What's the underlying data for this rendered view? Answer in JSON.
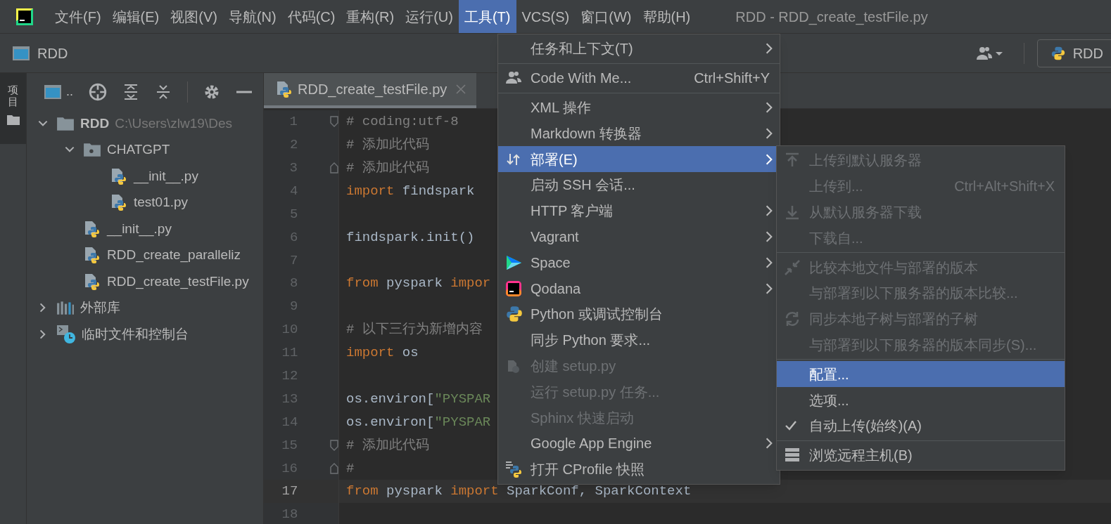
{
  "menubar": {
    "items": [
      {
        "label": "文件(F)",
        "selected": false
      },
      {
        "label": "编辑(E)",
        "selected": false
      },
      {
        "label": "视图(V)",
        "selected": false
      },
      {
        "label": "导航(N)",
        "selected": false
      },
      {
        "label": "代码(C)",
        "selected": false
      },
      {
        "label": "重构(R)",
        "selected": false
      },
      {
        "label": "运行(U)",
        "selected": false
      },
      {
        "label": "工具(T)",
        "selected": true
      },
      {
        "label": "VCS(S)",
        "selected": false
      },
      {
        "label": "窗口(W)",
        "selected": false
      },
      {
        "label": "帮助(H)",
        "selected": false
      }
    ],
    "title": "RDD - RDD_create_testFile.py"
  },
  "navbar": {
    "project": "RDD",
    "run_config": "RDD"
  },
  "side_strip": {
    "label": "项目"
  },
  "project_panel": {
    "toolbar_label": "..",
    "tree": [
      {
        "label": "RDD",
        "path": "C:\\Users\\zlw19\\Des",
        "kind": "folder",
        "expanded": true,
        "children": [
          {
            "label": "CHATGPT",
            "kind": "package",
            "expanded": true,
            "children": [
              {
                "label": "__init__.py",
                "kind": "file"
              },
              {
                "label": "test01.py",
                "kind": "file"
              }
            ]
          },
          {
            "label": "__init__.py",
            "kind": "file"
          },
          {
            "label": "RDD_create_paralleliz",
            "kind": "file"
          },
          {
            "label": "RDD_create_testFile.py",
            "kind": "file"
          }
        ]
      },
      {
        "label": "外部库",
        "kind": "library",
        "expanded": false
      },
      {
        "label": "临时文件和控制台",
        "kind": "scratch",
        "expanded": false
      }
    ]
  },
  "editor": {
    "tabs": [
      {
        "label": "RDD_create_testFile.py",
        "selected": true
      }
    ],
    "lines": [
      {
        "number": "1",
        "fold_start": true,
        "fold_end": false,
        "current": false,
        "tokens": [
          {
            "kind": "comment",
            "text": "# coding:utf-8"
          }
        ]
      },
      {
        "number": "2",
        "fold_start": false,
        "fold_end": false,
        "current": false,
        "tokens": [
          {
            "kind": "comment",
            "text": "# 添加此代码"
          }
        ]
      },
      {
        "number": "3",
        "fold_start": false,
        "fold_end": true,
        "current": false,
        "tokens": [
          {
            "kind": "comment",
            "text": "# 添加此代码"
          }
        ]
      },
      {
        "number": "4",
        "fold_start": false,
        "fold_end": false,
        "current": false,
        "tokens": [
          {
            "kind": "keyword",
            "text": "import "
          },
          {
            "kind": "plain",
            "text": "findspark"
          }
        ]
      },
      {
        "number": "5",
        "fold_start": false,
        "fold_end": false,
        "current": false
      },
      {
        "number": "6",
        "fold_start": false,
        "fold_end": false,
        "current": false,
        "tokens": [
          {
            "kind": "plain",
            "text": "findspark.init()"
          }
        ]
      },
      {
        "number": "7",
        "fold_start": false,
        "fold_end": false,
        "current": false
      },
      {
        "number": "8",
        "fold_start": false,
        "fold_end": false,
        "current": false,
        "tokens": [
          {
            "kind": "keyword",
            "text": "from "
          },
          {
            "kind": "plain",
            "text": "pyspark "
          },
          {
            "kind": "keyword",
            "text": "impor"
          }
        ]
      },
      {
        "number": "9",
        "fold_start": false,
        "fold_end": false,
        "current": false
      },
      {
        "number": "10",
        "fold_start": false,
        "fold_end": false,
        "current": false,
        "tokens": [
          {
            "kind": "comment",
            "text": "# 以下三行为新增内容"
          }
        ]
      },
      {
        "number": "11",
        "fold_start": false,
        "fold_end": false,
        "current": false,
        "tokens": [
          {
            "kind": "keyword",
            "text": "import "
          },
          {
            "kind": "plain",
            "text": "os"
          }
        ]
      },
      {
        "number": "12",
        "fold_start": false,
        "fold_end": false,
        "current": false
      },
      {
        "number": "13",
        "fold_start": false,
        "fold_end": false,
        "current": false,
        "tokens": [
          {
            "kind": "plain",
            "text": "os.environ["
          },
          {
            "kind": "string",
            "text": "\"PYSPAR"
          }
        ]
      },
      {
        "number": "14",
        "fold_start": false,
        "fold_end": false,
        "current": false,
        "tokens": [
          {
            "kind": "plain",
            "text": "os.environ["
          },
          {
            "kind": "string",
            "text": "\"PYSPAR"
          }
        ]
      },
      {
        "number": "15",
        "fold_start": true,
        "fold_end": false,
        "current": false,
        "tokens": [
          {
            "kind": "comment",
            "text": "# 添加此代码"
          }
        ]
      },
      {
        "number": "16",
        "fold_start": false,
        "fold_end": true,
        "current": false,
        "tokens": [
          {
            "kind": "comment",
            "text": "#"
          }
        ]
      },
      {
        "number": "17",
        "fold_start": false,
        "fold_end": false,
        "current": true,
        "tokens": [
          {
            "kind": "keyword",
            "text": "from "
          },
          {
            "kind": "plain",
            "text": "pyspark "
          },
          {
            "kind": "keyword",
            "text": "import "
          },
          {
            "kind": "plain",
            "text": "SparkConf, SparkContext"
          }
        ]
      },
      {
        "number": "18",
        "fold_start": false,
        "fold_end": false,
        "current": false
      }
    ]
  },
  "tools_menu": {
    "items": [
      {
        "kind": "plain",
        "label": "任务和上下文(T)",
        "submenu": true,
        "selected": false,
        "disabled": false
      },
      {
        "kind": "separator"
      },
      {
        "kind": "people",
        "label": "Code With Me...",
        "shortcut": "Ctrl+Shift+Y",
        "submenu": false,
        "selected": false,
        "disabled": false
      },
      {
        "kind": "separator"
      },
      {
        "kind": "plain",
        "label": "XML 操作",
        "submenu": true,
        "selected": false,
        "disabled": false
      },
      {
        "kind": "plain",
        "label": "Markdown 转换器",
        "submenu": true,
        "selected": false,
        "disabled": false
      },
      {
        "kind": "deploy",
        "label": "部署(E)",
        "submenu": true,
        "selected": true,
        "disabled": false
      },
      {
        "kind": "plain",
        "label": "启动 SSH 会话...",
        "submenu": false,
        "selected": false,
        "disabled": false
      },
      {
        "kind": "plain",
        "label": "HTTP 客户端",
        "submenu": true,
        "selected": false,
        "disabled": false
      },
      {
        "kind": "plain",
        "label": "Vagrant",
        "submenu": true,
        "selected": false,
        "disabled": false
      },
      {
        "kind": "space",
        "label": "Space",
        "submenu": true,
        "selected": false,
        "disabled": false
      },
      {
        "kind": "qodana",
        "label": "Qodana",
        "submenu": true,
        "selected": false,
        "disabled": false
      },
      {
        "kind": "python",
        "label": "Python 或调试控制台",
        "submenu": false,
        "selected": false,
        "disabled": false
      },
      {
        "kind": "plain",
        "label": "同步 Python 要求...",
        "submenu": false,
        "selected": false,
        "disabled": false
      },
      {
        "kind": "package",
        "label": "创建 setup.py",
        "submenu": false,
        "selected": false,
        "disabled": true
      },
      {
        "kind": "plain",
        "label": "运行 setup.py 任务...",
        "submenu": false,
        "selected": false,
        "disabled": true
      },
      {
        "kind": "plain",
        "label": "Sphinx 快速启动",
        "submenu": false,
        "selected": false,
        "disabled": true
      },
      {
        "kind": "plain",
        "label": "Google App Engine",
        "submenu": true,
        "selected": false,
        "disabled": false
      },
      {
        "kind": "profile",
        "label": "打开 CProfile 快照",
        "submenu": false,
        "selected": false,
        "disabled": false
      }
    ]
  },
  "deploy_submenu": {
    "items": [
      {
        "kind": "upload",
        "label": "上传到默认服务器",
        "disabled": true,
        "selected": false,
        "checked": false
      },
      {
        "kind": "plain",
        "label": "上传到...",
        "shortcut": "Ctrl+Alt+Shift+X",
        "disabled": true,
        "selected": false,
        "checked": false
      },
      {
        "kind": "download",
        "label": "从默认服务器下载",
        "disabled": true,
        "selected": false,
        "checked": false
      },
      {
        "kind": "plain",
        "label": "下载自...",
        "disabled": true,
        "selected": false,
        "checked": false
      },
      {
        "kind": "separator"
      },
      {
        "kind": "compare",
        "label": "比较本地文件与部署的版本",
        "disabled": true,
        "selected": false,
        "checked": false
      },
      {
        "kind": "plain",
        "label": "与部署到以下服务器的版本比较...",
        "disabled": true,
        "selected": false,
        "checked": false
      },
      {
        "kind": "sync",
        "label": "同步本地子树与部署的子树",
        "disabled": true,
        "selected": false,
        "checked": false
      },
      {
        "kind": "plain",
        "label": "与部署到以下服务器的版本同步(S)...",
        "disabled": true,
        "selected": false,
        "checked": false
      },
      {
        "kind": "separator"
      },
      {
        "kind": "plain",
        "label": "配置...",
        "disabled": false,
        "selected": true,
        "checked": false
      },
      {
        "kind": "plain",
        "label": "选项...",
        "disabled": false,
        "selected": false,
        "checked": false
      },
      {
        "kind": "plain",
        "label": "自动上传(始终)(A)",
        "disabled": false,
        "selected": false,
        "checked": true
      },
      {
        "kind": "separator"
      },
      {
        "kind": "server",
        "label": "浏览远程主机(B)",
        "disabled": false,
        "selected": false,
        "checked": false
      }
    ]
  }
}
